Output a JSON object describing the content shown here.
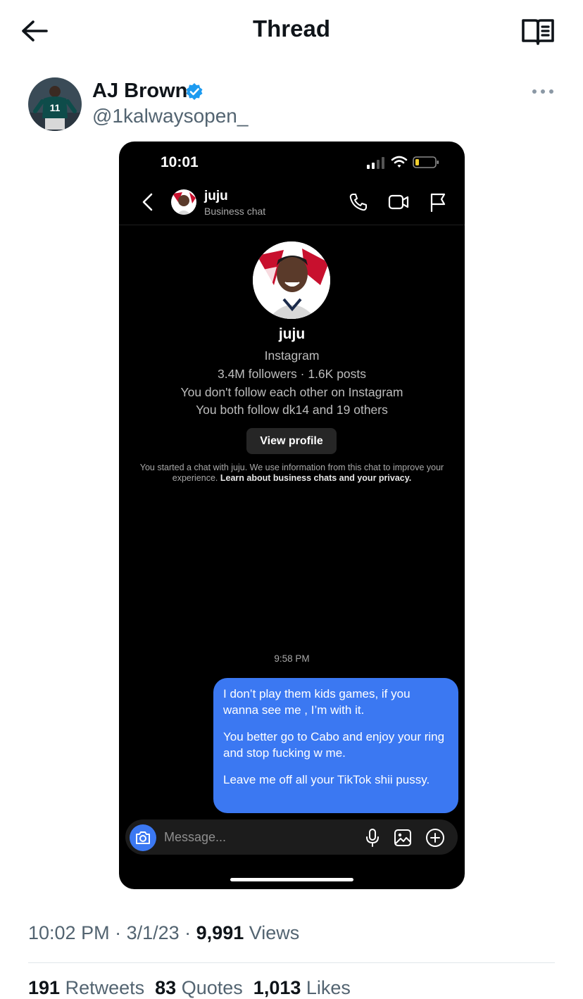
{
  "header": {
    "title": "Thread"
  },
  "author": {
    "name": "AJ Brown",
    "handle": "@1kalwaysopen_"
  },
  "phone": {
    "status_time": "10:01",
    "chat_name": "juju",
    "chat_subtitle": "Business chat",
    "profile_name": "juju",
    "profile_source": "Instagram",
    "profile_stats": "3.4M followers · 1.6K posts",
    "follow_status": "You don't follow each other on Instagram",
    "mutuals": "You both follow dk14 and 19 others",
    "view_profile_label": "View profile",
    "info_text": "You started a chat with juju. We use information from this chat to improve your experience.",
    "info_link": "Learn about business chats and your privacy.",
    "timestamp": "9:58 PM",
    "message_paragraphs": [
      "I don’t play them kids games, if you wanna see me , I’m with it.",
      "You better go to Cabo and enjoy your ring and stop fucking w me.",
      "Leave me off all your TikTok shii pussy."
    ],
    "composer_placeholder": "Message...",
    "accent_color": "#3b78f2"
  },
  "tweet_meta": {
    "time": "10:02 PM",
    "date": "3/1/23",
    "views_count": "9,991",
    "views_label": "Views"
  },
  "engagement": {
    "retweets_count": "191",
    "retweets_label": "Retweets",
    "quotes_count": "83",
    "quotes_label": "Quotes",
    "likes_count": "1,013",
    "likes_label": "Likes"
  },
  "icons": [
    "back-arrow-icon",
    "reader-icon",
    "verified-badge-icon",
    "more-icon",
    "call-icon",
    "video-icon",
    "flag-icon",
    "camera-icon",
    "mic-icon",
    "image-icon",
    "plus-icon"
  ],
  "colors": {
    "verified": "#1d9bf0",
    "secondary_text": "#536471",
    "bubble": "#3b78f2"
  }
}
